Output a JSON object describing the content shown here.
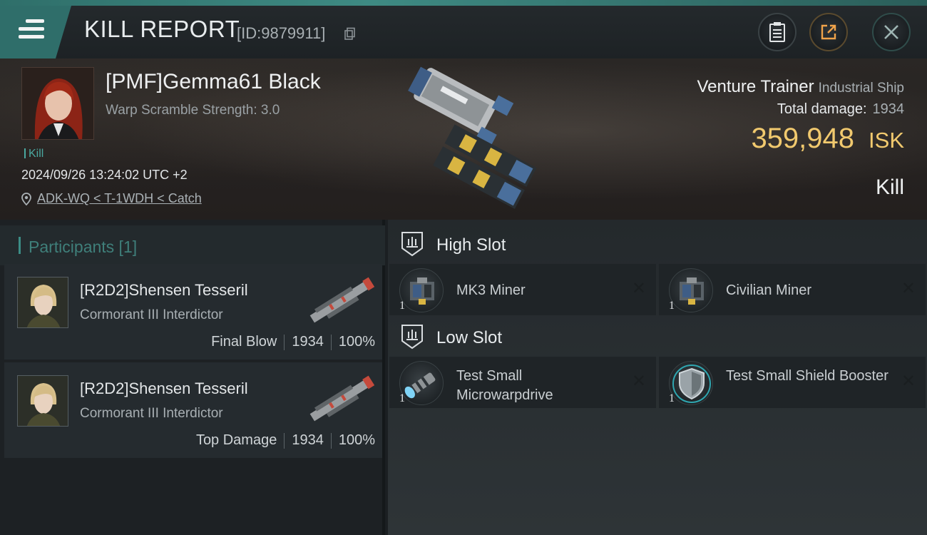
{
  "header": {
    "title": "KILL REPORT",
    "report_id": "[ID:9879911]",
    "buttons": {
      "copy_icon": "clipboard-icon",
      "share_icon": "share-icon",
      "close_icon": "close-icon"
    }
  },
  "victim": {
    "pilot_name": "[PMF]Gemma61 Black",
    "warp_scramble": "Warp Scramble Strength: 3.0",
    "tag": "Kill",
    "datetime": "2024/09/26 13:24:02 UTC +2",
    "location": "ADK-WQ < T-1WDH < Catch",
    "ship_name": "Venture Trainer",
    "ship_class": "Industrial Ship",
    "total_damage_label": "Total damage:",
    "total_damage": "1934",
    "isk_value": "359,948",
    "isk_unit": "ISK",
    "result": "Kill"
  },
  "participants": {
    "title": "Participants [1]",
    "items": [
      {
        "name": "[R2D2]Shensen Tesseril",
        "ship": "Cormorant III Interdictor",
        "role": "Final Blow",
        "damage": "1934",
        "percent": "100%"
      },
      {
        "name": "[R2D2]Shensen Tesseril",
        "ship": "Cormorant III Interdictor",
        "role": "Top Damage",
        "damage": "1934",
        "percent": "100%"
      }
    ]
  },
  "fitting": {
    "high_slot": {
      "title": "High Slot",
      "modules": [
        {
          "name": "MK3 Miner",
          "qty": "1",
          "state": "✕"
        },
        {
          "name": "Civilian Miner",
          "qty": "1",
          "state": "✕"
        }
      ]
    },
    "low_slot": {
      "title": "Low Slot",
      "modules": [
        {
          "name": "Test Small Microwarpdrive",
          "qty": "1",
          "state": "✕"
        },
        {
          "name": "Test Small Shield Booster",
          "qty": "1",
          "state": "✕"
        }
      ]
    }
  },
  "colors": {
    "accent": "#3c8d86",
    "isk": "#f1c96e",
    "tag": "#4aa8a0"
  }
}
